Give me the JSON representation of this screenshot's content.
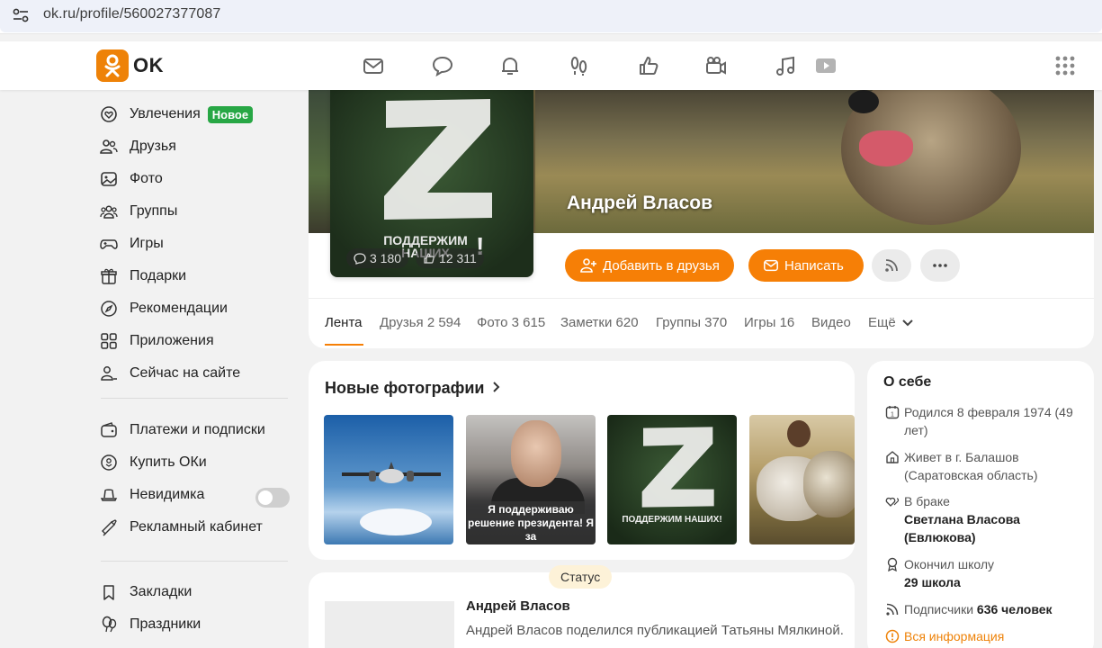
{
  "browser": {
    "url": "ok.ru/profile/560027377087"
  },
  "header": {
    "logo_text": "OK",
    "nav_icons": [
      "mail-icon",
      "chat-icon",
      "bell-icon",
      "footprints-icon",
      "like-icon",
      "video-camera-icon",
      "music-icon",
      "video-play-icon"
    ],
    "apps_icon": "apps-grid-icon"
  },
  "sidebar": {
    "items": [
      {
        "label": "Увлечения",
        "icon": "hobby-icon",
        "badge": "Новое"
      },
      {
        "label": "Друзья",
        "icon": "friends-icon"
      },
      {
        "label": "Фото",
        "icon": "photo-icon"
      },
      {
        "label": "Группы",
        "icon": "groups-icon"
      },
      {
        "label": "Игры",
        "icon": "games-icon"
      },
      {
        "label": "Подарки",
        "icon": "gift-icon"
      },
      {
        "label": "Рекомендации",
        "icon": "compass-icon"
      },
      {
        "label": "Приложения",
        "icon": "apps-icon"
      },
      {
        "label": "Сейчас на сайте",
        "icon": "online-users-icon"
      },
      {
        "label": "Платежи и подписки",
        "icon": "wallet-icon"
      },
      {
        "label": "Купить ОКи",
        "icon": "coin-icon"
      },
      {
        "label": "Невидимка",
        "icon": "invisible-hat-icon",
        "toggle": false
      },
      {
        "label": "Рекламный кабинет",
        "icon": "megaphone-icon"
      },
      {
        "label": "Закладки",
        "icon": "bookmark-icon"
      },
      {
        "label": "Праздники",
        "icon": "balloons-icon"
      }
    ]
  },
  "profile": {
    "name": "Андрей Власов",
    "avatar_caption": "ПОДДЕРЖИМ НАШИХ",
    "avatar_exclamation": "!",
    "avatar_comments": "3 180",
    "avatar_likes": "12 311",
    "add_friend_label": "Добавить в друзья",
    "write_label": "Написать",
    "tabs": [
      {
        "label": "Лента",
        "count": ""
      },
      {
        "label": "Друзья",
        "count": "2 594"
      },
      {
        "label": "Фото",
        "count": "3 615"
      },
      {
        "label": "Заметки",
        "count": "620"
      },
      {
        "label": "Группы",
        "count": "370"
      },
      {
        "label": "Игры",
        "count": "16"
      },
      {
        "label": "Видео",
        "count": ""
      },
      {
        "label": "Ещё",
        "count": ""
      }
    ]
  },
  "new_photos": {
    "title": "Новые фотографии",
    "photo2_caption": "Я поддерживаю решение президента! Я за",
    "photo3_caption": "ПОДДЕРЖИМ НАШИХ!"
  },
  "about": {
    "title": "О себе",
    "born": "Родился 8 февраля 1974 (49 лет)",
    "lives": "Живет в г. Балашов (Саратовская область)",
    "married_prefix": "В браке",
    "spouse": "Светлана Власова (Евлюкова)",
    "school_prefix": "Окончил школу",
    "school": "29 школа",
    "subscribers_prefix": "Подписчики",
    "subscribers": "636 человек",
    "all_info": "Вся информация"
  },
  "feed": {
    "status_label": "Статус",
    "author": "Андрей Власов",
    "text": "Андрей Власов поделился публикацией Татьяны Мялкиной."
  },
  "colors": {
    "accent": "#f67f06",
    "badge_green": "#28a745",
    "logo_orange": "#ee8208"
  }
}
